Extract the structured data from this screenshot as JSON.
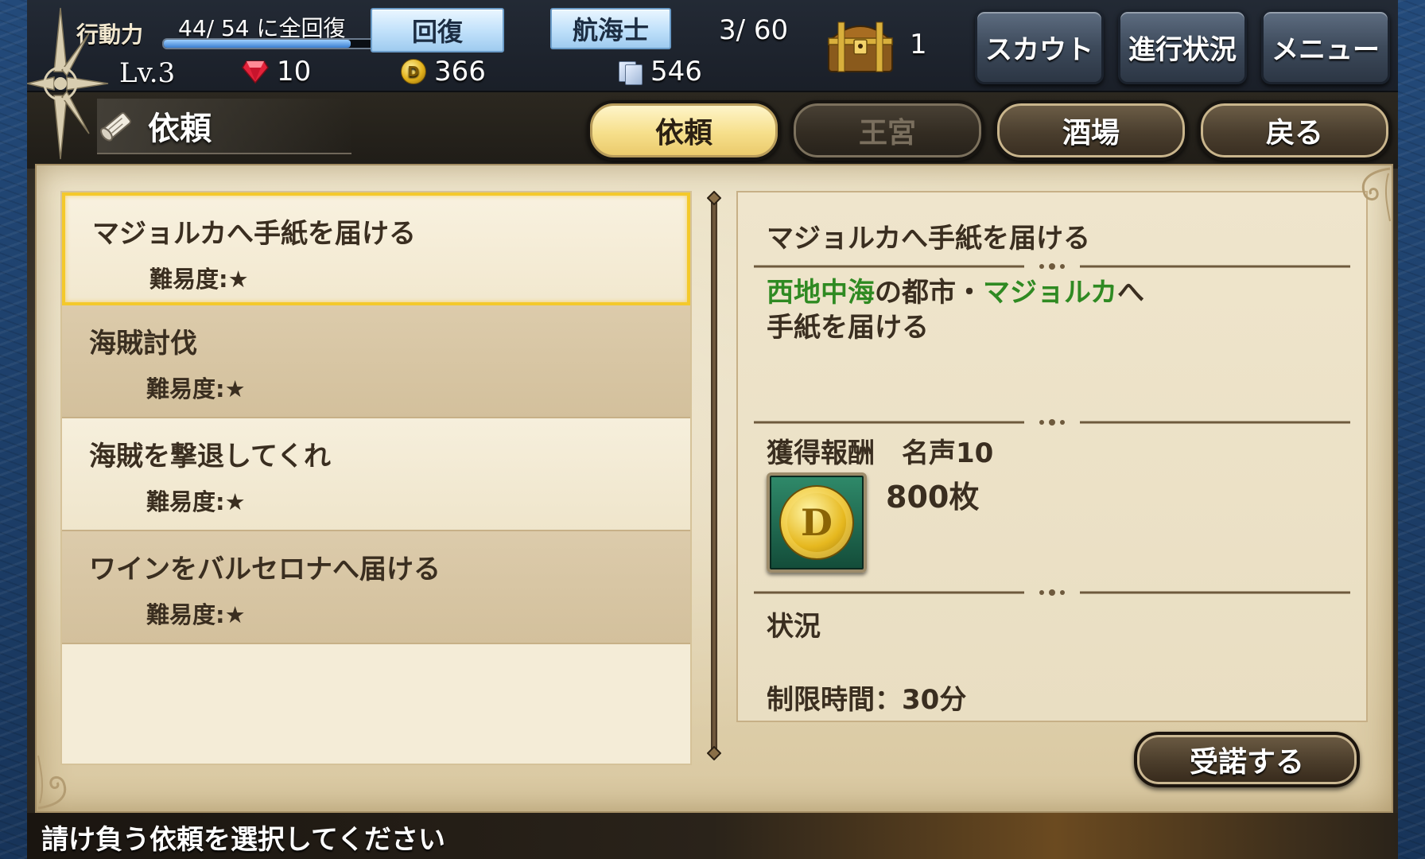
{
  "topbar": {
    "ap_label": "行動力",
    "ap_text": "44/ 54  に全回復",
    "ap_fraction": 0.81,
    "recover_label": "回復",
    "rank_label": "航海士",
    "captain_count": "3/ 60",
    "level": "Lv.3",
    "gems": "10",
    "gold": "366",
    "cards": "546",
    "chest_count": "1",
    "scout_label": "スカウト",
    "progress_label": "進行状況",
    "menu_label": "メニュー"
  },
  "header": {
    "title": "依頼",
    "tabs": [
      {
        "label": "依頼",
        "state": "active"
      },
      {
        "label": "王宮",
        "state": "disabled"
      },
      {
        "label": "酒場",
        "state": "normal"
      },
      {
        "label": "戻る",
        "state": "normal"
      }
    ]
  },
  "quests": [
    {
      "title": "マジョルカへ手紙を届ける",
      "difficulty": "難易度:★"
    },
    {
      "title": "海賊討伐",
      "difficulty": "難易度:★"
    },
    {
      "title": "海賊を撃退してくれ",
      "difficulty": "難易度:★"
    },
    {
      "title": "ワインをバルセロナへ届ける",
      "difficulty": "難易度:★"
    }
  ],
  "detail": {
    "title": "マジョルカへ手紙を届ける",
    "desc_place": "西地中海",
    "desc_mid": "の都市・",
    "desc_city": "マジョルカ",
    "desc_end": "へ",
    "desc_line2": "手紙を届ける",
    "reward_label": "獲得報酬　名声10",
    "reward_amount": "800枚",
    "status_label": "状況",
    "time_limit": "制限時間：30分",
    "accept_label": "受諾する"
  },
  "footer": {
    "hint": "請け負う依頼を選択してください"
  },
  "colors": {
    "accent_gold": "#f4c92b",
    "green_text": "#2f8a22",
    "parchment": "#e4d6b4"
  }
}
